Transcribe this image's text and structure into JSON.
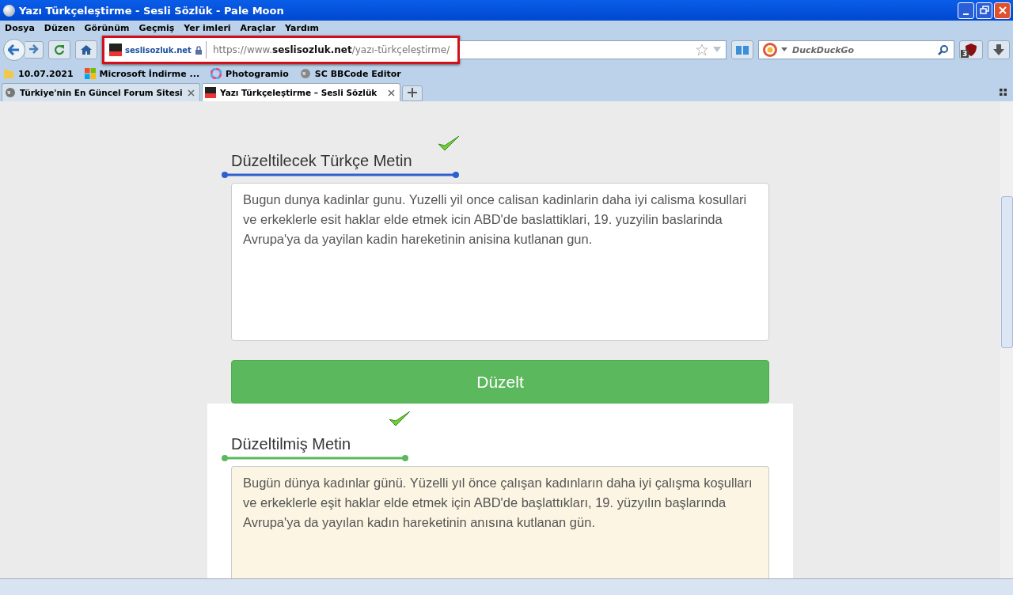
{
  "window": {
    "title": "Yazı Türkçeleştirme - Sesli Sözlük - Pale Moon"
  },
  "menu": [
    "Dosya",
    "Düzen",
    "Görünüm",
    "Geçmiş",
    "Yer imleri",
    "Araçlar",
    "Yardım"
  ],
  "toolbar": {
    "site": "seslisozluk.net",
    "url": "https://www.**seslisozluk.net**/yazı-türkçeleştirme/",
    "search": {
      "placeholder": "DuckDuckGo"
    },
    "blocked_count": "3"
  },
  "bookmarks": [
    {
      "kind": "folder",
      "label": "10.07.2021"
    },
    {
      "kind": "windows",
      "label": "Microsoft İndirme ..."
    },
    {
      "kind": "photo",
      "label": "Photogramio"
    },
    {
      "kind": "globe",
      "label": "SC BBCode Editor"
    }
  ],
  "tabs": [
    {
      "label": "Türkiye'nin En Güncel Forum Sitesi",
      "selected": false
    },
    {
      "label": "Yazı Türkçeleştirme – Sesli Sözlük",
      "selected": true
    }
  ],
  "input": {
    "heading": "Düzeltilecek Türkçe Metin",
    "text": "Bugun dunya kadinlar gunu. Yuzelli yil once calisan kadinlarin daha iyi calisma kosullari ve erkeklerle esit haklar elde etmek icin ABD'de baslattiklari, 19. yuzyilin baslarinda Avrupa'ya da yayilan kadin hareketinin anisina kutlanan gun."
  },
  "button": "Düzelt",
  "output": {
    "heading": "Düzeltilmiş Metin",
    "text": "Bugün dünya kadınlar günü. Yüzelli yıl önce çalışan kadınların daha iyi çalışma koşulları ve erkeklerle eşit haklar elde etmek için ABD'de başlattıkları, 19. yüzyılın başlarında Avrupa'ya da yayılan kadın hareketinin anısına kutlanan gün."
  }
}
